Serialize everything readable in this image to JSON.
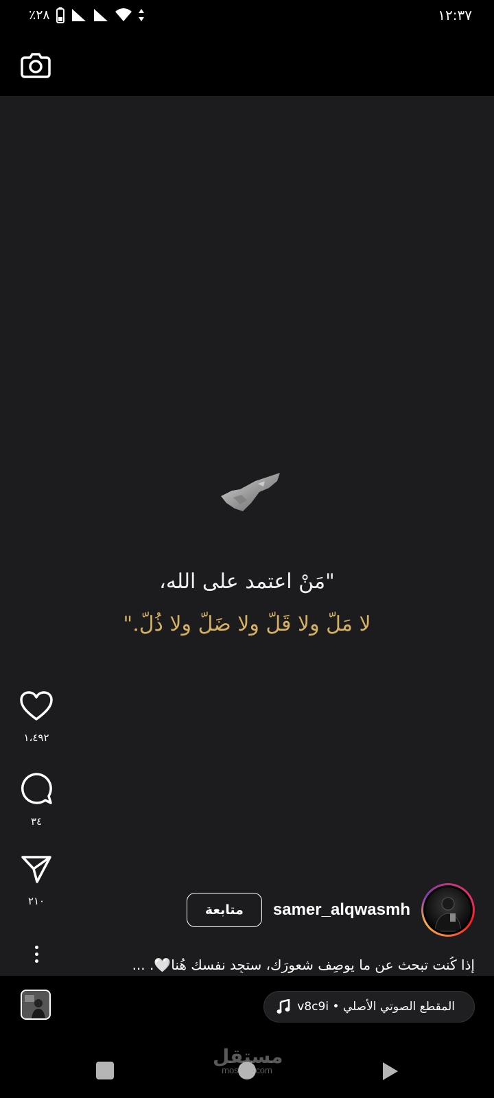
{
  "status_bar": {
    "battery_percent": "٪٢٨",
    "time": "١٢:٣٧"
  },
  "reel": {
    "quote_line1": "\"مَنْ اعتمد على الله،",
    "quote_line2": "لا مَلّ ولا قَلّ ولا ضَلّ ولا ذُلّ.\"",
    "quote_accent_color": "#d4b062"
  },
  "actions": {
    "likes": "١،٤٩٢",
    "comments": "٣٤",
    "shares": "٢١٠"
  },
  "author": {
    "username": "samer_alqwasmh",
    "follow_label": "متابعة"
  },
  "caption": "إذا كُنت تبحث عن ما يوصِف شعورَك، ستجِد نفسك هُنا🤍. ...",
  "audio": {
    "label": "المقطع الصوتي الأصلي • v8c9i"
  },
  "watermark": {
    "brand": "مستقل",
    "domain": "mostaql.com"
  }
}
